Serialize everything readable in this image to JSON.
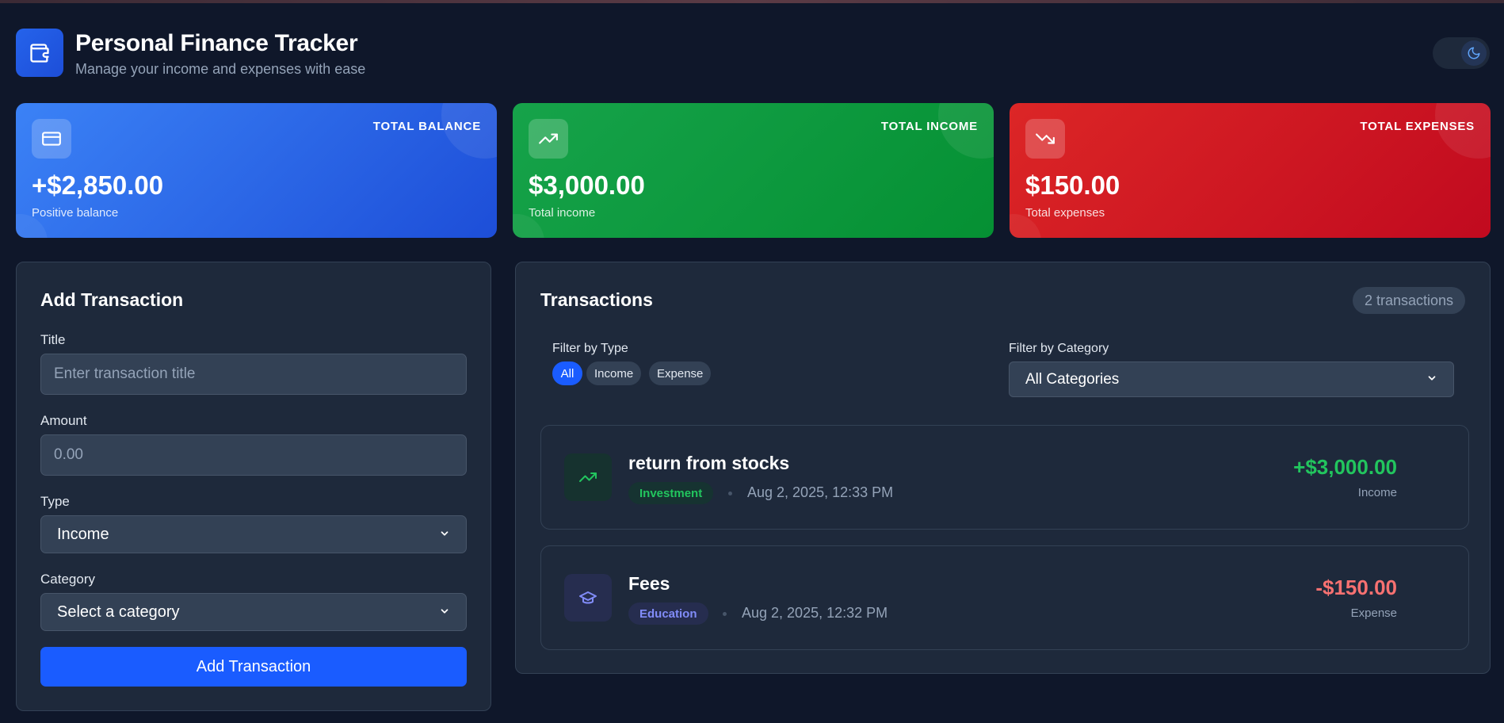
{
  "header": {
    "title": "Personal Finance Tracker",
    "subtitle": "Manage your income and expenses with ease",
    "logo_icon": "wallet-icon",
    "theme_icon": "moon-icon"
  },
  "stats": {
    "balance": {
      "label": "TOTAL BALANCE",
      "value": "+$2,850.00",
      "note": "Positive balance",
      "icon": "credit-card-icon",
      "color": "#2563eb"
    },
    "income": {
      "label": "TOTAL INCOME",
      "value": "$3,000.00",
      "note": "Total income",
      "icon": "trending-up-icon",
      "color": "#16a34a"
    },
    "expense": {
      "label": "TOTAL EXPENSES",
      "value": "$150.00",
      "note": "Total expenses",
      "icon": "trending-down-icon",
      "color": "#dc2626"
    }
  },
  "add_form": {
    "heading": "Add Transaction",
    "title_label": "Title",
    "title_placeholder": "Enter transaction title",
    "amount_label": "Amount",
    "amount_placeholder": "0.00",
    "type_label": "Type",
    "type_value": "Income",
    "category_label": "Category",
    "category_value": "Select a category",
    "submit_label": "Add Transaction"
  },
  "transactions": {
    "heading": "Transactions",
    "count": "2 transactions",
    "filter_type_label": "Filter by Type",
    "filter_types": [
      "All",
      "Income",
      "Expense"
    ],
    "active_filter": "All",
    "filter_category_label": "Filter by Category",
    "filter_category_value": "All Categories",
    "items": [
      {
        "title": "return from stocks",
        "category": "Investment",
        "date": "Aug 2, 2025, 12:33 PM",
        "amount": "+$3,000.00",
        "type": "Income",
        "icon": "trending-up-icon",
        "amount_color": "#22c55e"
      },
      {
        "title": "Fees",
        "category": "Education",
        "date": "Aug 2, 2025, 12:32 PM",
        "amount": "-$150.00",
        "type": "Expense",
        "icon": "graduation-cap-icon",
        "amount_color": "#f87171"
      }
    ]
  },
  "colors": {
    "background": "#0f172a",
    "panel": "#1e293b",
    "accent": "#1a5cff"
  }
}
